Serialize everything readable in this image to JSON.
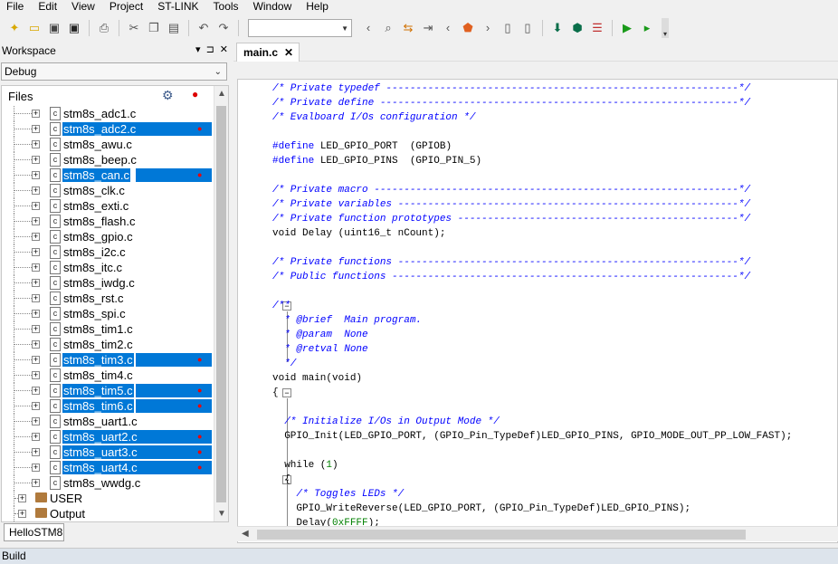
{
  "menu": [
    "File",
    "Edit",
    "View",
    "Project",
    "ST-LINK",
    "Tools",
    "Window",
    "Help"
  ],
  "workspace": {
    "title": "Workspace",
    "title_controls": [
      "▾",
      "⊐",
      "✕"
    ],
    "config_value": "Debug",
    "files_header": "Files",
    "files": [
      {
        "name": "stm8s_adc1.c",
        "selected": false
      },
      {
        "name": "stm8s_adc2.c",
        "selected": true
      },
      {
        "name": "stm8s_awu.c",
        "selected": false
      },
      {
        "name": "stm8s_beep.c",
        "selected": false
      },
      {
        "name": "stm8s_can.c",
        "selected": true
      },
      {
        "name": "stm8s_clk.c",
        "selected": false
      },
      {
        "name": "stm8s_exti.c",
        "selected": false
      },
      {
        "name": "stm8s_flash.c",
        "selected": false
      },
      {
        "name": "stm8s_gpio.c",
        "selected": false
      },
      {
        "name": "stm8s_i2c.c",
        "selected": false
      },
      {
        "name": "stm8s_itc.c",
        "selected": false
      },
      {
        "name": "stm8s_iwdg.c",
        "selected": false
      },
      {
        "name": "stm8s_rst.c",
        "selected": false
      },
      {
        "name": "stm8s_spi.c",
        "selected": false
      },
      {
        "name": "stm8s_tim1.c",
        "selected": false
      },
      {
        "name": "stm8s_tim2.c",
        "selected": false
      },
      {
        "name": "stm8s_tim3.c",
        "selected": true
      },
      {
        "name": "stm8s_tim4.c",
        "selected": false
      },
      {
        "name": "stm8s_tim5.c",
        "selected": true
      },
      {
        "name": "stm8s_tim6.c",
        "selected": true
      },
      {
        "name": "stm8s_uart1.c",
        "selected": false
      },
      {
        "name": "stm8s_uart2.c",
        "selected": true
      },
      {
        "name": "stm8s_uart3.c",
        "selected": true
      },
      {
        "name": "stm8s_uart4.c",
        "selected": true
      },
      {
        "name": "stm8s_wwdg.c",
        "selected": false
      }
    ],
    "groups": [
      "USER",
      "Output"
    ],
    "tab_label": "HelloSTM8"
  },
  "editor": {
    "tab_label": "main.c",
    "close_glyph": "✕",
    "code_lines": [
      {
        "segments": [
          {
            "t": "/* Private typedef -----------------------------------------------------------*/",
            "c": "cm"
          }
        ]
      },
      {
        "segments": [
          {
            "t": "/* Private define ------------------------------------------------------------*/",
            "c": "cm"
          }
        ]
      },
      {
        "segments": [
          {
            "t": "/* Evalboard I/Os configuration */",
            "c": "cm"
          }
        ]
      },
      {
        "segments": [
          {
            "t": "",
            "c": ""
          }
        ]
      },
      {
        "segments": [
          {
            "t": "#define",
            "c": "pp"
          },
          {
            "t": " LED_GPIO_PORT  (GPIOB)",
            "c": ""
          }
        ]
      },
      {
        "segments": [
          {
            "t": "#define",
            "c": "pp"
          },
          {
            "t": " LED_GPIO_PINS  (GPIO_PIN_5)",
            "c": ""
          }
        ]
      },
      {
        "segments": [
          {
            "t": "",
            "c": ""
          }
        ]
      },
      {
        "segments": [
          {
            "t": "/* Private macro -------------------------------------------------------------*/",
            "c": "cm"
          }
        ]
      },
      {
        "segments": [
          {
            "t": "/* Private variables ---------------------------------------------------------*/",
            "c": "cm"
          }
        ]
      },
      {
        "segments": [
          {
            "t": "/* Private function prototypes -----------------------------------------------*/",
            "c": "cm"
          }
        ]
      },
      {
        "segments": [
          {
            "t": "void Delay (uint16_t nCount);",
            "c": ""
          }
        ]
      },
      {
        "segments": [
          {
            "t": "",
            "c": ""
          }
        ]
      },
      {
        "segments": [
          {
            "t": "/* Private functions ---------------------------------------------------------*/",
            "c": "cm"
          }
        ]
      },
      {
        "segments": [
          {
            "t": "/* Public functions ----------------------------------------------------------*/",
            "c": "cm"
          }
        ]
      },
      {
        "segments": [
          {
            "t": "",
            "c": ""
          }
        ]
      },
      {
        "segments": [
          {
            "t": "/**",
            "c": "cm"
          }
        ]
      },
      {
        "segments": [
          {
            "t": "  * @brief  Main program.",
            "c": "cm"
          }
        ]
      },
      {
        "segments": [
          {
            "t": "  * @param  None",
            "c": "cm"
          }
        ]
      },
      {
        "segments": [
          {
            "t": "  * @retval None",
            "c": "cm"
          }
        ]
      },
      {
        "segments": [
          {
            "t": "  */",
            "c": "cm"
          }
        ]
      },
      {
        "segments": [
          {
            "t": "void main(void)",
            "c": ""
          }
        ]
      },
      {
        "segments": [
          {
            "t": "{",
            "c": ""
          }
        ]
      },
      {
        "segments": [
          {
            "t": "",
            "c": ""
          }
        ]
      },
      {
        "segments": [
          {
            "t": "  ",
            "c": ""
          },
          {
            "t": "/* Initialize I/Os in Output Mode */",
            "c": "cm"
          }
        ]
      },
      {
        "segments": [
          {
            "t": "  GPIO_Init(LED_GPIO_PORT, (GPIO_Pin_TypeDef)LED_GPIO_PINS, GPIO_MODE_OUT_PP_LOW_FAST);",
            "c": ""
          }
        ]
      },
      {
        "segments": [
          {
            "t": "",
            "c": ""
          }
        ]
      },
      {
        "segments": [
          {
            "t": "  while (",
            "c": ""
          },
          {
            "t": "1",
            "c": "num"
          },
          {
            "t": ")",
            "c": ""
          }
        ]
      },
      {
        "segments": [
          {
            "t": "  {",
            "c": ""
          }
        ]
      },
      {
        "segments": [
          {
            "t": "    ",
            "c": ""
          },
          {
            "t": "/* Toggles LEDs */",
            "c": "cm"
          }
        ]
      },
      {
        "segments": [
          {
            "t": "    GPIO_WriteReverse(LED_GPIO_PORT, (GPIO_Pin_TypeDef)LED_GPIO_PINS);",
            "c": ""
          }
        ]
      },
      {
        "segments": [
          {
            "t": "    Delay(",
            "c": ""
          },
          {
            "t": "0xFFFF",
            "c": "num"
          },
          {
            "t": ");",
            "c": ""
          }
        ]
      }
    ]
  },
  "status": {
    "text": "Build"
  },
  "toolbar_icons": [
    "new-file-icon",
    "open-icon",
    "save-icon",
    "save-all-icon",
    "print-icon",
    "cut-icon",
    "copy-icon",
    "paste-icon",
    "undo-icon",
    "redo-icon",
    "back-icon",
    "find-icon",
    "replace-icon",
    "indent-icon",
    "prev-icon",
    "bookmark-icon",
    "prev-bookmark-icon",
    "next-bookmark-icon",
    "download-icon",
    "debug-icon",
    "breakpoints-icon",
    "go-icon",
    "run-icon"
  ],
  "colors": {
    "selection": "#0078d7",
    "comment": "#0000ff",
    "number": "#008000"
  }
}
